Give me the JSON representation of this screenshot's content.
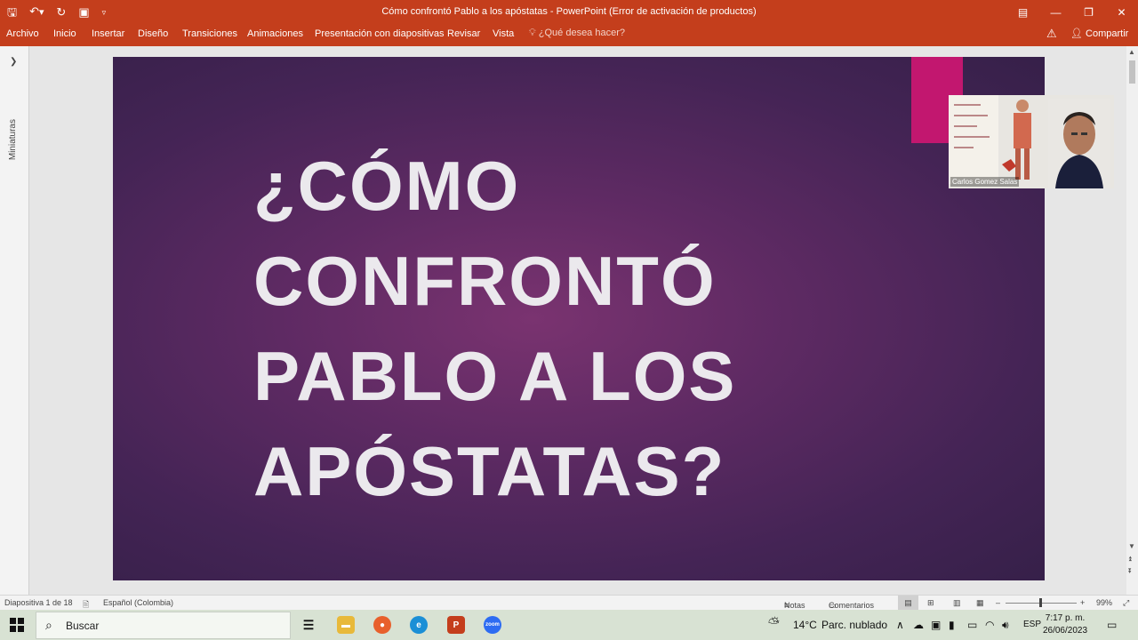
{
  "window": {
    "title": "Cómo confrontó Pablo a los apóstatas - PowerPoint (Error de activación de productos)"
  },
  "ribbon": {
    "tabs": [
      "Archivo",
      "Inicio",
      "Insertar",
      "Diseño",
      "Transiciones",
      "Animaciones",
      "Presentación con diapositivas",
      "Revisar",
      "Vista"
    ],
    "tell_me": "¿Qué desea hacer?",
    "share": "Compartir"
  },
  "thumbnail_pane": {
    "label": "Miniaturas"
  },
  "slide": {
    "title_lines": [
      "¿CÓMO",
      "CONFRONTÓ",
      "PABLO A LOS",
      "APÓSTATAS?"
    ],
    "background_color": "#5e2a63",
    "accent_color": "#c2176f"
  },
  "video": {
    "participant_name": "Carlos Gomez Salas"
  },
  "statusbar": {
    "slide_count": "Diapositiva 1 de 18",
    "language": "Español (Colombia)",
    "notes": "Notas",
    "comments": "Comentarios",
    "zoom": "99%",
    "zoom_fraction": 0.49
  },
  "taskbar": {
    "search_placeholder": "Buscar",
    "weather_temp": "14°C",
    "weather_desc": "Parc. nublado",
    "input_lang": "ESP",
    "time": "7:17 p. m.",
    "date": "26/06/2023"
  },
  "colors": {
    "accent": "#c43e1c",
    "taskbar": "#d8e2d3"
  }
}
